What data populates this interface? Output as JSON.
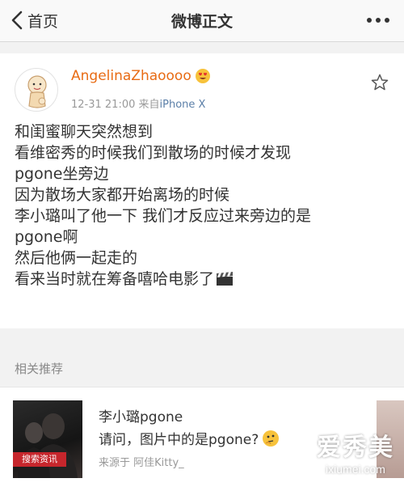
{
  "nav": {
    "back_label": "首页",
    "title": "微博正文"
  },
  "post": {
    "username": "AngelinaZhaoooo",
    "timestamp": "12-31 21:00",
    "source_prefix": "来自",
    "device": "iPhone X",
    "lines": [
      "和闺蜜聊天突然想到",
      "看维密秀的时候我们到散场的时候才发现",
      "pgone坐旁边",
      "因为散场大家都开始离场的时候",
      "李小璐叫了他一下 我们才反应过来旁边的是",
      "pgone啊",
      "然后他俩一起走的",
      "看来当时就在筹备嘻哈电影了"
    ],
    "username_color": "#e86b14"
  },
  "related": {
    "section_title": "相关推荐",
    "thumb_badge": "搜索资讯",
    "item_title": "李小璐pgone",
    "item_subtitle": "请问，图片中的是pgone?",
    "item_source": "来源于  阿佳Kitty_"
  },
  "watermark": {
    "brand": "爱秀美",
    "domain": "ixiumei.com"
  }
}
